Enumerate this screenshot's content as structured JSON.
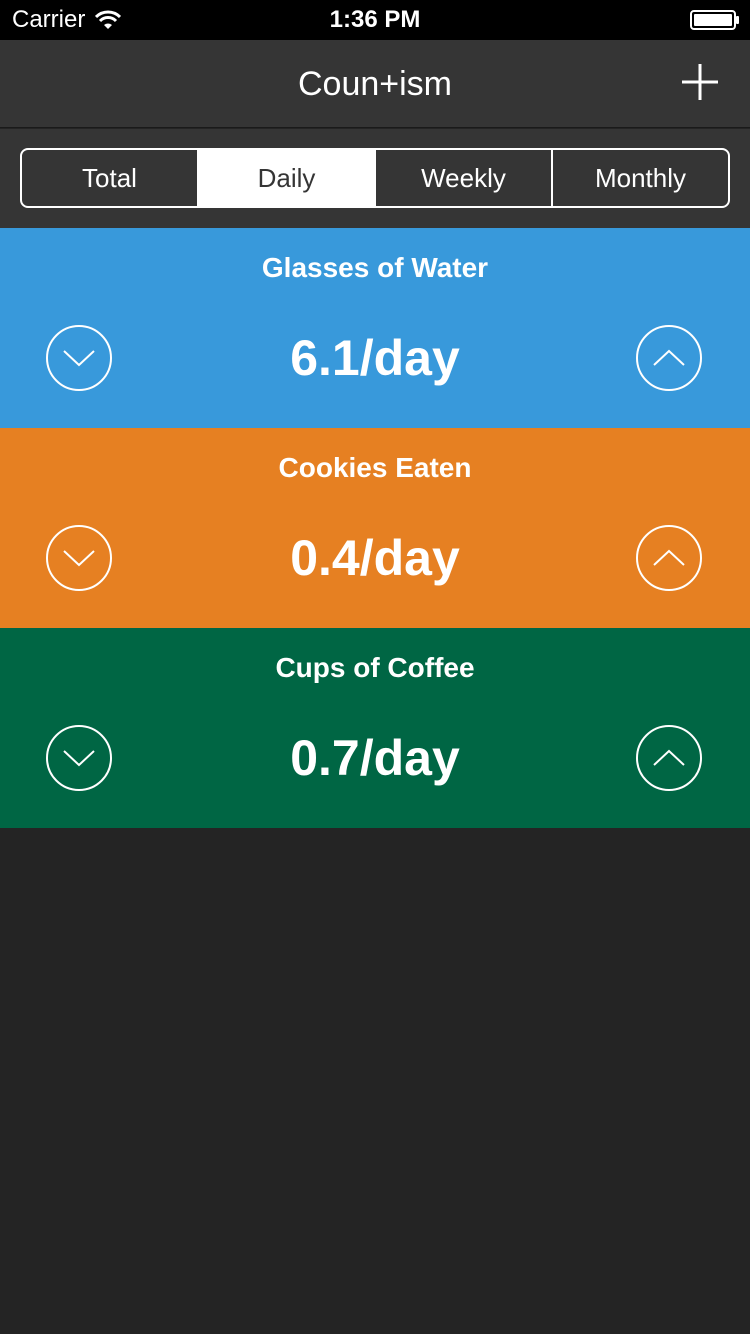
{
  "status_bar": {
    "carrier": "Carrier",
    "time": "1:36 PM",
    "wifi_icon": "wifi-icon",
    "battery_icon": "battery-icon"
  },
  "nav": {
    "title": "Coun+ism",
    "add_icon": "plus-icon"
  },
  "segments": {
    "items": [
      {
        "label": "Total",
        "active": false
      },
      {
        "label": "Daily",
        "active": true
      },
      {
        "label": "Weekly",
        "active": false
      },
      {
        "label": "Monthly",
        "active": false
      }
    ]
  },
  "counters": [
    {
      "title": "Glasses of Water",
      "value": "6.1/day",
      "color": "#3899DB"
    },
    {
      "title": "Cookies Eaten",
      "value": "0.4/day",
      "color": "#E68022"
    },
    {
      "title": "Cups of Coffee",
      "value": "0.7/day",
      "color": "#006644"
    }
  ],
  "colors": {
    "background": "#242424",
    "nav_background": "#353535",
    "status_bar": "#000000"
  }
}
